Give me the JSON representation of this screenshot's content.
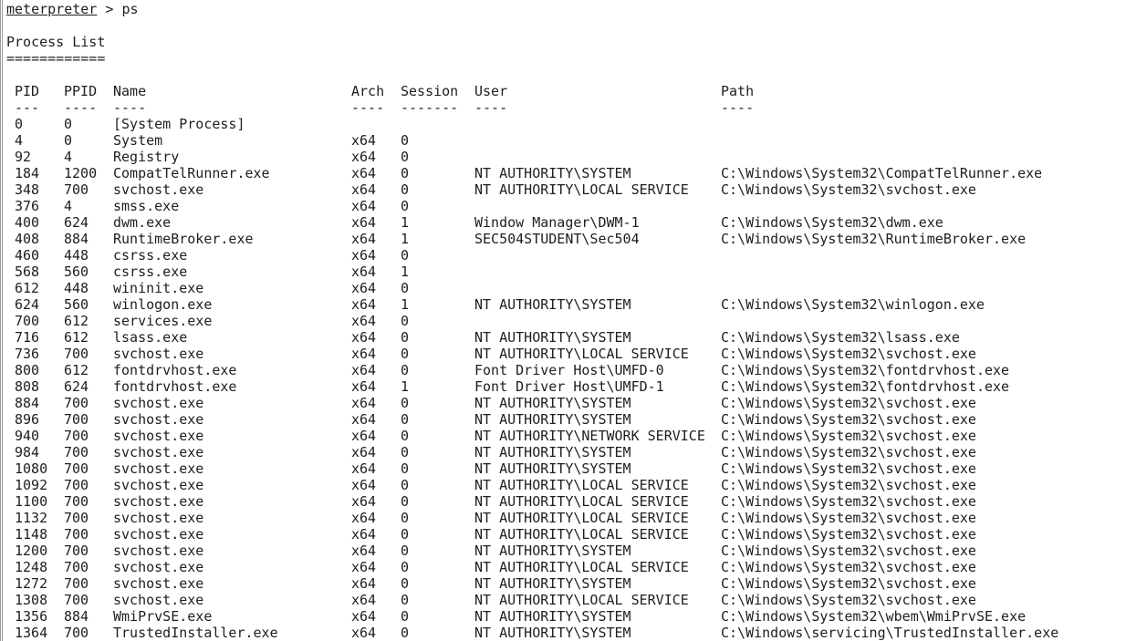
{
  "prompt": {
    "name": "meterpreter",
    "separator": " > ",
    "command": "ps"
  },
  "title": "Process List",
  "title_underline": "============",
  "columns": {
    "pid": "PID",
    "ppid": "PPID",
    "name": "Name",
    "arch": "Arch",
    "session": "Session",
    "user": "User",
    "path": "Path"
  },
  "dividers": {
    "pid": "---",
    "ppid": "----",
    "name": "----",
    "arch": "----",
    "session": "-------",
    "user": "----",
    "path": "----"
  },
  "rows": [
    {
      "pid": "0",
      "ppid": "0",
      "name": "[System Process]",
      "arch": "",
      "session": "",
      "user": "",
      "path": ""
    },
    {
      "pid": "4",
      "ppid": "0",
      "name": "System",
      "arch": "x64",
      "session": "0",
      "user": "",
      "path": ""
    },
    {
      "pid": "92",
      "ppid": "4",
      "name": "Registry",
      "arch": "x64",
      "session": "0",
      "user": "",
      "path": ""
    },
    {
      "pid": "184",
      "ppid": "1200",
      "name": "CompatTelRunner.exe",
      "arch": "x64",
      "session": "0",
      "user": "NT AUTHORITY\\SYSTEM",
      "path": "C:\\Windows\\System32\\CompatTelRunner.exe"
    },
    {
      "pid": "348",
      "ppid": "700",
      "name": "svchost.exe",
      "arch": "x64",
      "session": "0",
      "user": "NT AUTHORITY\\LOCAL SERVICE",
      "path": "C:\\Windows\\System32\\svchost.exe"
    },
    {
      "pid": "376",
      "ppid": "4",
      "name": "smss.exe",
      "arch": "x64",
      "session": "0",
      "user": "",
      "path": ""
    },
    {
      "pid": "400",
      "ppid": "624",
      "name": "dwm.exe",
      "arch": "x64",
      "session": "1",
      "user": "Window Manager\\DWM-1",
      "path": "C:\\Windows\\System32\\dwm.exe"
    },
    {
      "pid": "408",
      "ppid": "884",
      "name": "RuntimeBroker.exe",
      "arch": "x64",
      "session": "1",
      "user": "SEC504STUDENT\\Sec504",
      "path": "C:\\Windows\\System32\\RuntimeBroker.exe"
    },
    {
      "pid": "460",
      "ppid": "448",
      "name": "csrss.exe",
      "arch": "x64",
      "session": "0",
      "user": "",
      "path": ""
    },
    {
      "pid": "568",
      "ppid": "560",
      "name": "csrss.exe",
      "arch": "x64",
      "session": "1",
      "user": "",
      "path": ""
    },
    {
      "pid": "612",
      "ppid": "448",
      "name": "wininit.exe",
      "arch": "x64",
      "session": "0",
      "user": "",
      "path": ""
    },
    {
      "pid": "624",
      "ppid": "560",
      "name": "winlogon.exe",
      "arch": "x64",
      "session": "1",
      "user": "NT AUTHORITY\\SYSTEM",
      "path": "C:\\Windows\\System32\\winlogon.exe"
    },
    {
      "pid": "700",
      "ppid": "612",
      "name": "services.exe",
      "arch": "x64",
      "session": "0",
      "user": "",
      "path": ""
    },
    {
      "pid": "716",
      "ppid": "612",
      "name": "lsass.exe",
      "arch": "x64",
      "session": "0",
      "user": "NT AUTHORITY\\SYSTEM",
      "path": "C:\\Windows\\System32\\lsass.exe"
    },
    {
      "pid": "736",
      "ppid": "700",
      "name": "svchost.exe",
      "arch": "x64",
      "session": "0",
      "user": "NT AUTHORITY\\LOCAL SERVICE",
      "path": "C:\\Windows\\System32\\svchost.exe"
    },
    {
      "pid": "800",
      "ppid": "612",
      "name": "fontdrvhost.exe",
      "arch": "x64",
      "session": "0",
      "user": "Font Driver Host\\UMFD-0",
      "path": "C:\\Windows\\System32\\fontdrvhost.exe"
    },
    {
      "pid": "808",
      "ppid": "624",
      "name": "fontdrvhost.exe",
      "arch": "x64",
      "session": "1",
      "user": "Font Driver Host\\UMFD-1",
      "path": "C:\\Windows\\System32\\fontdrvhost.exe"
    },
    {
      "pid": "884",
      "ppid": "700",
      "name": "svchost.exe",
      "arch": "x64",
      "session": "0",
      "user": "NT AUTHORITY\\SYSTEM",
      "path": "C:\\Windows\\System32\\svchost.exe"
    },
    {
      "pid": "896",
      "ppid": "700",
      "name": "svchost.exe",
      "arch": "x64",
      "session": "0",
      "user": "NT AUTHORITY\\SYSTEM",
      "path": "C:\\Windows\\System32\\svchost.exe"
    },
    {
      "pid": "940",
      "ppid": "700",
      "name": "svchost.exe",
      "arch": "x64",
      "session": "0",
      "user": "NT AUTHORITY\\NETWORK SERVICE",
      "path": "C:\\Windows\\System32\\svchost.exe"
    },
    {
      "pid": "984",
      "ppid": "700",
      "name": "svchost.exe",
      "arch": "x64",
      "session": "0",
      "user": "NT AUTHORITY\\SYSTEM",
      "path": "C:\\Windows\\System32\\svchost.exe"
    },
    {
      "pid": "1080",
      "ppid": "700",
      "name": "svchost.exe",
      "arch": "x64",
      "session": "0",
      "user": "NT AUTHORITY\\SYSTEM",
      "path": "C:\\Windows\\System32\\svchost.exe"
    },
    {
      "pid": "1092",
      "ppid": "700",
      "name": "svchost.exe",
      "arch": "x64",
      "session": "0",
      "user": "NT AUTHORITY\\LOCAL SERVICE",
      "path": "C:\\Windows\\System32\\svchost.exe"
    },
    {
      "pid": "1100",
      "ppid": "700",
      "name": "svchost.exe",
      "arch": "x64",
      "session": "0",
      "user": "NT AUTHORITY\\LOCAL SERVICE",
      "path": "C:\\Windows\\System32\\svchost.exe"
    },
    {
      "pid": "1132",
      "ppid": "700",
      "name": "svchost.exe",
      "arch": "x64",
      "session": "0",
      "user": "NT AUTHORITY\\LOCAL SERVICE",
      "path": "C:\\Windows\\System32\\svchost.exe"
    },
    {
      "pid": "1148",
      "ppid": "700",
      "name": "svchost.exe",
      "arch": "x64",
      "session": "0",
      "user": "NT AUTHORITY\\LOCAL SERVICE",
      "path": "C:\\Windows\\System32\\svchost.exe"
    },
    {
      "pid": "1200",
      "ppid": "700",
      "name": "svchost.exe",
      "arch": "x64",
      "session": "0",
      "user": "NT AUTHORITY\\SYSTEM",
      "path": "C:\\Windows\\System32\\svchost.exe"
    },
    {
      "pid": "1248",
      "ppid": "700",
      "name": "svchost.exe",
      "arch": "x64",
      "session": "0",
      "user": "NT AUTHORITY\\LOCAL SERVICE",
      "path": "C:\\Windows\\System32\\svchost.exe"
    },
    {
      "pid": "1272",
      "ppid": "700",
      "name": "svchost.exe",
      "arch": "x64",
      "session": "0",
      "user": "NT AUTHORITY\\SYSTEM",
      "path": "C:\\Windows\\System32\\svchost.exe"
    },
    {
      "pid": "1308",
      "ppid": "700",
      "name": "svchost.exe",
      "arch": "x64",
      "session": "0",
      "user": "NT AUTHORITY\\LOCAL SERVICE",
      "path": "C:\\Windows\\System32\\svchost.exe"
    },
    {
      "pid": "1356",
      "ppid": "884",
      "name": "WmiPrvSE.exe",
      "arch": "x64",
      "session": "0",
      "user": "NT AUTHORITY\\SYSTEM",
      "path": "C:\\Windows\\System32\\wbem\\WmiPrvSE.exe"
    },
    {
      "pid": "1364",
      "ppid": "700",
      "name": "TrustedInstaller.exe",
      "arch": "x64",
      "session": "0",
      "user": "NT AUTHORITY\\SYSTEM",
      "path": "C:\\Windows\\servicing\\TrustedInstaller.exe"
    }
  ]
}
